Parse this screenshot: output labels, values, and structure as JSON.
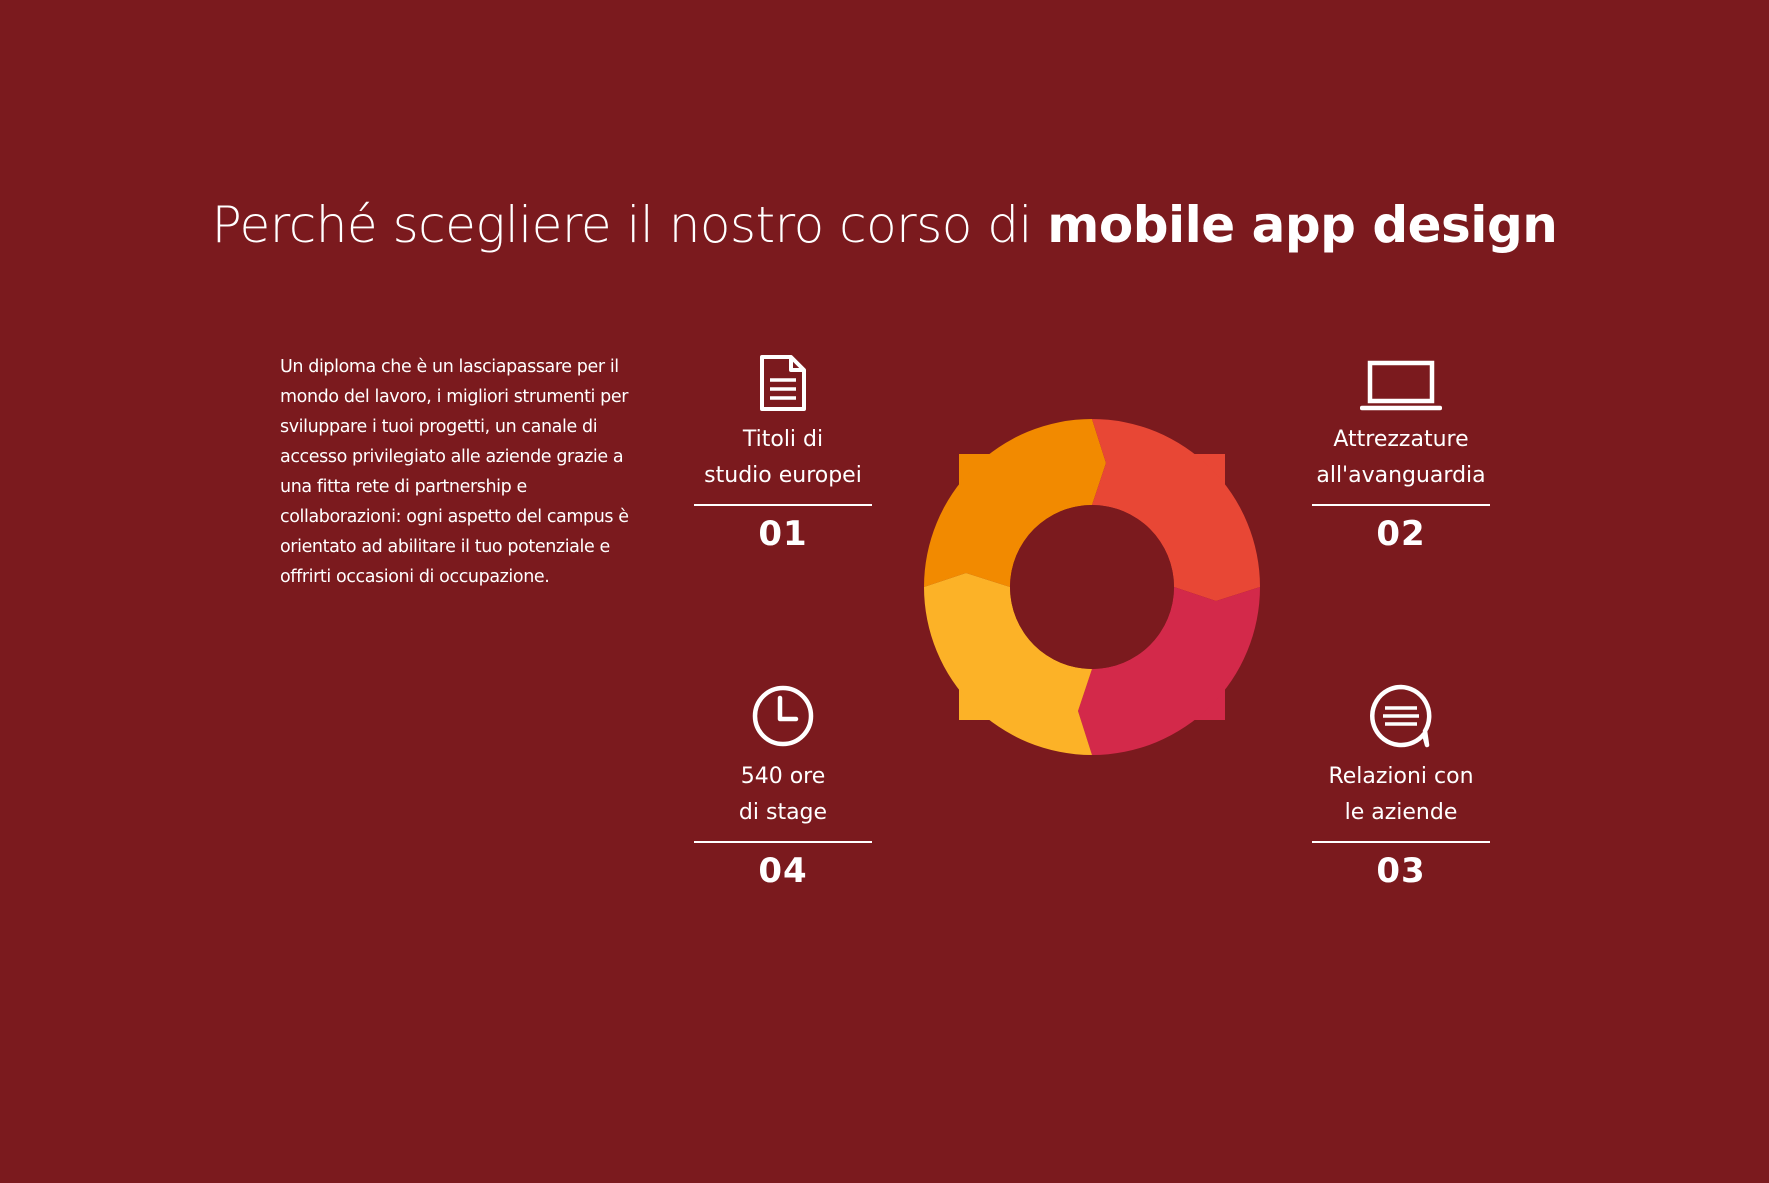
{
  "header": {
    "title_light": "Perché scegliere il nostro corso di ",
    "title_bold": "mobile app design"
  },
  "intro": {
    "text": "Un diploma che è un lasciapassare per il mondo del lavoro, i migliori strumenti per sviluppare i tuoi progetti, un canale di accesso privilegiato alle aziende grazie a una fitta rete di partnership e collaborazioni: ogni aspetto del campus è orientato ad abilitare il tuo potenziale e offrirti occasioni di occupazione."
  },
  "features": [
    {
      "icon": "document-icon",
      "label": "Titoli di\nstudio europei",
      "number": "01"
    },
    {
      "icon": "laptop-icon",
      "label": "Attrezzature\nall'avanguardia",
      "number": "02"
    },
    {
      "icon": "chat-bubble-icon",
      "label": "Relazioni con\nle aziende",
      "number": "03"
    },
    {
      "icon": "clock-icon",
      "label": "540 ore\ndi stage",
      "number": "04"
    }
  ],
  "cycle": {
    "segments": [
      {
        "name": "top-left",
        "color": "#f28a00"
      },
      {
        "name": "top-right",
        "color": "#e84735"
      },
      {
        "name": "bottom-right",
        "color": "#d3294a"
      },
      {
        "name": "bottom-left",
        "color": "#fcb227"
      }
    ],
    "background": "#7b1a1e"
  }
}
